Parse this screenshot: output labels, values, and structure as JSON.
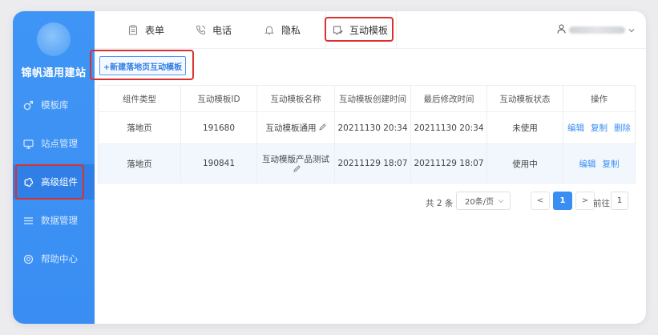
{
  "sidebar": {
    "brand": "锦帆通用建站",
    "items": [
      {
        "label": "模板库",
        "icon": "male-icon"
      },
      {
        "label": "站点管理",
        "icon": "monitor-icon"
      },
      {
        "label": "高级组件",
        "icon": "flower-icon",
        "active": true
      },
      {
        "label": "数据管理",
        "icon": "list-icon"
      },
      {
        "label": "帮助中心",
        "icon": "help-icon"
      }
    ]
  },
  "topbar": {
    "tabs": [
      {
        "label": "表单",
        "icon": "clipboard-icon"
      },
      {
        "label": "电话",
        "icon": "phone-icon"
      },
      {
        "label": "隐私",
        "icon": "bell-icon"
      },
      {
        "label": "互动模板",
        "icon": "chat-edit-icon",
        "active": true
      }
    ],
    "user_chevron": "chevron-down-icon"
  },
  "toolbar": {
    "new_button": "+新建落地页互动模板"
  },
  "table": {
    "headers": [
      "组件类型",
      "互动模板ID",
      "互动模板名称",
      "互动模板创建时间",
      "最后修改时间",
      "互动模板状态",
      "操作"
    ],
    "rows": [
      {
        "type": "落地页",
        "id": "191680",
        "name": "互动模板通用",
        "created": "20211130 20:34",
        "modified": "20211130 20:34",
        "status": "未使用",
        "ops": [
          "编辑",
          "复制",
          "删除"
        ]
      },
      {
        "type": "落地页",
        "id": "190841",
        "name": "互动模版产品测试",
        "created": "20211129 18:07",
        "modified": "20211129 18:07",
        "status": "使用中",
        "ops": [
          "编辑",
          "复制"
        ]
      }
    ]
  },
  "pagination": {
    "total": "共 2 条",
    "page_size": "20条/页",
    "prev": "<",
    "current": "1",
    "next": ">",
    "goto_label": "前往",
    "goto_value": "1"
  },
  "colors": {
    "accent": "#3a8ef3",
    "highlight": "#d9312f",
    "sidebar": "#3f95f5"
  }
}
